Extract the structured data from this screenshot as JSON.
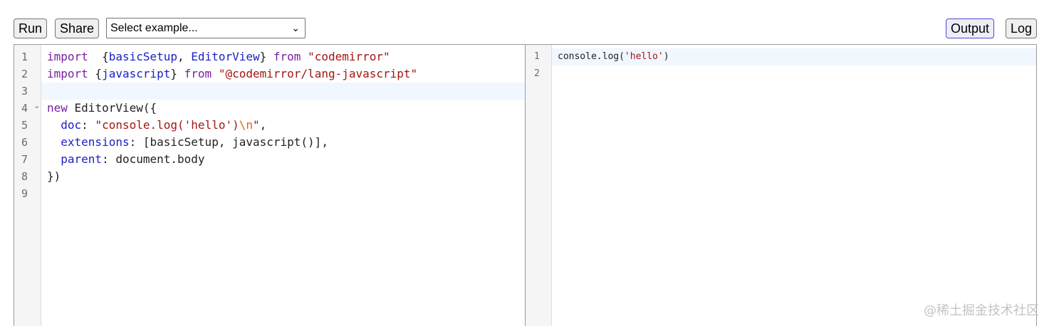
{
  "toolbar": {
    "run_label": "Run",
    "share_label": "Share",
    "select_value": "Select example...",
    "output_label": "Output",
    "log_label": "Log"
  },
  "editor": {
    "line_numbers": [
      "1",
      "2",
      "3",
      "4",
      "5",
      "6",
      "7",
      "8",
      "9"
    ],
    "lines": [
      [
        [
          "kw",
          "import"
        ],
        [
          "",
          "  {"
        ],
        [
          "def",
          "basicSetup"
        ],
        [
          "",
          ", "
        ],
        [
          "def",
          "EditorView"
        ],
        [
          "",
          "} "
        ],
        [
          "kw",
          "from"
        ],
        [
          "",
          " "
        ],
        [
          "str",
          "\"codemirror\""
        ]
      ],
      [
        [
          "kw",
          "import"
        ],
        [
          "",
          " {"
        ],
        [
          "def",
          "javascript"
        ],
        [
          "",
          "} "
        ],
        [
          "kw",
          "from"
        ],
        [
          "",
          " "
        ],
        [
          "str",
          "\"@codemirror/lang-javascript\""
        ]
      ],
      [],
      [
        [
          "kw",
          "new"
        ],
        [
          "",
          " EditorView({"
        ]
      ],
      [
        [
          "",
          "  "
        ],
        [
          "prop",
          "doc"
        ],
        [
          "",
          ": "
        ],
        [
          "str",
          "\"console.log('hello')"
        ],
        [
          "esc",
          "\\n"
        ],
        [
          "str",
          "\""
        ],
        [
          "",
          ","
        ]
      ],
      [
        [
          "",
          "  "
        ],
        [
          "prop",
          "extensions"
        ],
        [
          "",
          ": [basicSetup, javascript()],"
        ]
      ],
      [
        [
          "",
          "  "
        ],
        [
          "prop",
          "parent"
        ],
        [
          "",
          ": document.body"
        ]
      ],
      [
        [
          "",
          "})"
        ]
      ],
      []
    ]
  },
  "output": {
    "line_numbers": [
      "1",
      "2"
    ],
    "lines": [
      [
        [
          "",
          "console.log("
        ],
        [
          "str",
          "'hello'"
        ],
        [
          "",
          ")"
        ]
      ],
      []
    ]
  },
  "watermark": "@稀土掘金技术社区"
}
